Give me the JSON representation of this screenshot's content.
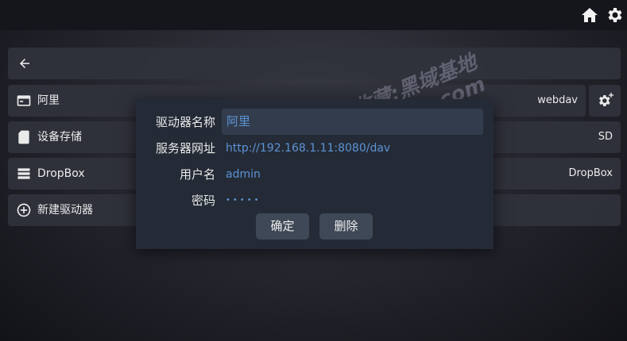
{
  "topbar": {
    "home_icon": "home-icon",
    "settings_icon": "gear-icon"
  },
  "header": {
    "back_icon": "arrow-left-icon"
  },
  "drives": [
    {
      "label": "阿里",
      "right": "webdav",
      "icon": "window-icon"
    },
    {
      "label": "设备存储",
      "right": "SD",
      "icon": "sd-card-icon"
    },
    {
      "label": "DropBox",
      "right": "DropBox",
      "icon": "server-icon"
    },
    {
      "label": "新建驱动器",
      "right": "",
      "icon": "plus-circle-icon"
    }
  ],
  "watermark": {
    "line1": "记得收藏:黑域基地",
    "line2": "Hybase.com"
  },
  "dialog": {
    "name_label": "驱动器名称",
    "name_value": "阿里",
    "url_label": "服务器网址",
    "url_value": "http://192.168.1.11:8080/dav",
    "user_label": "用户名",
    "user_value": "admin",
    "password_label": "密码",
    "password_value": "•••••",
    "confirm_label": "确定",
    "delete_label": "删除"
  },
  "colors": {
    "accent": "#5d93d6",
    "dialog_bg": "#242b36",
    "row_bg": "#30323c"
  }
}
